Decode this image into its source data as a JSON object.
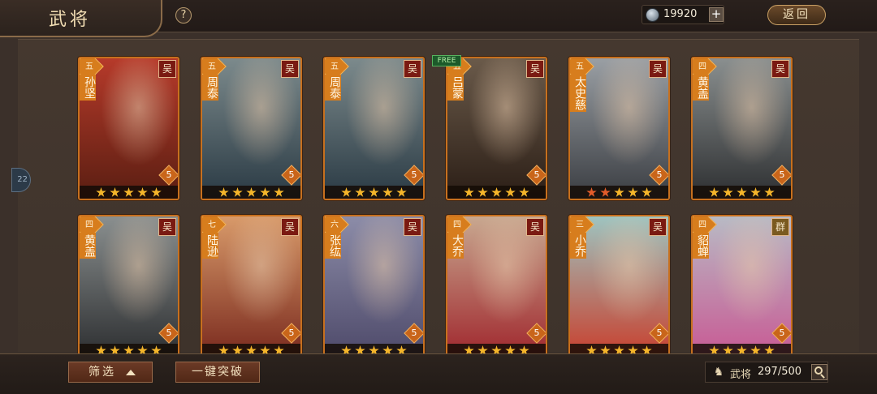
{
  "header": {
    "title": "武将",
    "help_label": "?",
    "coin_value": "19920",
    "coin_plus": "+",
    "back_label": "返回"
  },
  "side_tab_label": "22",
  "new_badge": "FREE",
  "cards": [
    {
      "rank": "五",
      "name": "孙坚",
      "faction": "吴",
      "level": "5",
      "stars": 5,
      "red_stars": 0,
      "bg_top": "#b63a2a",
      "bg_bottom": "#5a1e12"
    },
    {
      "rank": "五",
      "name": "周泰",
      "faction": "吴",
      "level": "5",
      "stars": 5,
      "red_stars": 0,
      "bg_top": "#7c8a8c",
      "bg_bottom": "#2a3a44"
    },
    {
      "rank": "五",
      "name": "周泰",
      "faction": "吴",
      "level": "5",
      "stars": 5,
      "red_stars": 0,
      "bg_top": "#7c8a8c",
      "bg_bottom": "#2a3a44"
    },
    {
      "rank": "五",
      "name": "吕蒙",
      "faction": "吴",
      "level": "5",
      "stars": 5,
      "red_stars": 0,
      "bg_top": "#6a5a4a",
      "bg_bottom": "#2b1e16"
    },
    {
      "rank": "五",
      "name": "太史慈",
      "faction": "吴",
      "level": "5",
      "stars": 5,
      "red_stars": 2,
      "bg_top": "#9a9fa4",
      "bg_bottom": "#3a3d42"
    },
    {
      "rank": "四",
      "name": "黄盖",
      "faction": "吴",
      "level": "5",
      "stars": 5,
      "red_stars": 0,
      "bg_top": "#8a8f8f",
      "bg_bottom": "#2d2f31"
    },
    {
      "rank": "四",
      "name": "黄盖",
      "faction": "吴",
      "level": "5",
      "stars": 5,
      "red_stars": 0,
      "bg_top": "#8a8f8f",
      "bg_bottom": "#2d2f31"
    },
    {
      "rank": "七",
      "name": "陆逊",
      "faction": "吴",
      "level": "5",
      "stars": 5,
      "red_stars": 0,
      "bg_top": "#d89a6a",
      "bg_bottom": "#7a2a1e"
    },
    {
      "rank": "六",
      "name": "张纮",
      "faction": "吴",
      "level": "5",
      "stars": 5,
      "red_stars": 0,
      "bg_top": "#8c8ca8",
      "bg_bottom": "#4e4a6a"
    },
    {
      "rank": "四",
      "name": "大乔",
      "faction": "吴",
      "level": "5",
      "stars": 5,
      "red_stars": 0,
      "bg_top": "#c8a890",
      "bg_bottom": "#a0282e"
    },
    {
      "rank": "三",
      "name": "小乔",
      "faction": "吴",
      "level": "5",
      "stars": 5,
      "red_stars": 0,
      "bg_top": "#9ec4c0",
      "bg_bottom": "#c8402e"
    },
    {
      "rank": "四",
      "name": "貂蝉",
      "faction": "群",
      "level": "5",
      "stars": 5,
      "red_stars": 0,
      "bg_top": "#b8bac4",
      "bg_bottom": "#c85a94"
    }
  ],
  "footer": {
    "filter_label": "筛选",
    "breakthrough_label": "一键突破",
    "count_label": "武将",
    "count_value": "297/500"
  }
}
